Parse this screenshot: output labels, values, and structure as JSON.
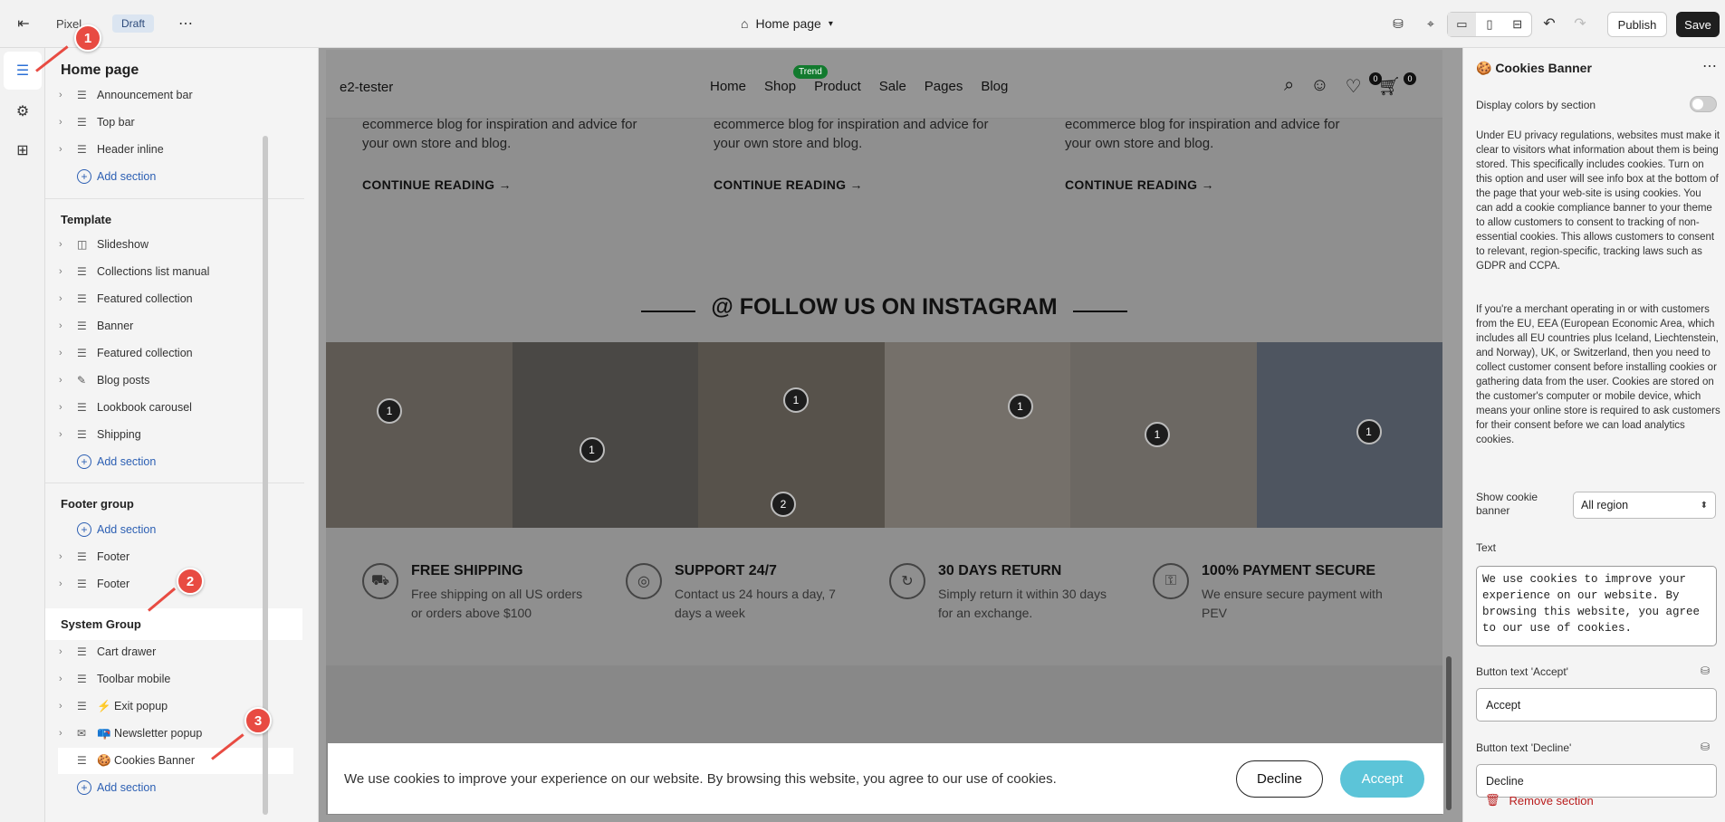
{
  "topbar": {
    "exit_icon": "exit-icon",
    "page_name_partial": "Pixel",
    "status_badge": "Draft",
    "more_icon": "more-horizontal-icon",
    "page_selector": "Home page",
    "publish_label": "Publish",
    "save_label": "Save"
  },
  "left_panel": {
    "title": "Home page",
    "header_items": [
      "Announcement bar",
      "Top bar",
      "Header inline"
    ],
    "add_section": "Add section",
    "template_title": "Template",
    "template_items": [
      "Slideshow",
      "Collections list manual",
      "Featured collection",
      "Banner",
      "Featured collection",
      "Blog posts",
      "Lookbook carousel",
      "Shipping"
    ],
    "footer_title": "Footer group",
    "footer_items": [
      "Footer",
      "Footer"
    ],
    "system_title": "System Group",
    "system_items": [
      "Cart drawer",
      "Toolbar mobile",
      "⚡ Exit popup",
      "📪 Newsletter popup",
      "🍪 Cookies Banner"
    ]
  },
  "store": {
    "logo": "e2-tester",
    "menu": [
      "Home",
      "Shop",
      "Product",
      "Sale",
      "Pages",
      "Blog"
    ],
    "trend_badge": "Trend",
    "wishlist_count": "0",
    "cart_count": "0",
    "blog_excerpt": "ecommerce blog for inspiration and advice for your own store and blog.",
    "continue_reading": "CONTINUE READING →",
    "instagram_heading": "@ FOLLOW US ON INSTAGRAM",
    "tile_pins": [
      [
        "1"
      ],
      [
        "1"
      ],
      [
        "1",
        "2"
      ],
      [
        "1"
      ],
      [
        "1"
      ],
      [
        "1"
      ]
    ],
    "features": [
      {
        "title": "FREE SHIPPING",
        "text": "Free shipping on all US orders or orders above $100"
      },
      {
        "title": "SUPPORT 24/7",
        "text": "Contact us 24 hours a day, 7 days a week"
      },
      {
        "title": "30 DAYS RETURN",
        "text": "Simply return it within 30 days for an exchange."
      },
      {
        "title": "100% PAYMENT SECURE",
        "text": "We ensure secure payment with PEV"
      }
    ],
    "cookie_text": "We use cookies to improve your experience on our website. By browsing this website, you agree to our use of cookies.",
    "decline_label": "Decline",
    "accept_label": "Accept"
  },
  "right_panel": {
    "title": "🍪 Cookies Banner",
    "display_colors_label": "Display colors by section",
    "desc1": "Under EU privacy regulations, websites must make it clear to visitors what information about them is being stored. This specifically includes cookies. Turn on this option and user will see info box at the bottom of the page that your web-site is using cookies. You can add a cookie compliance banner to your theme to allow customers to consent to tracking of non-essential cookies. This allows customers to consent to relevant, region-specific, tracking laws such as GDPR and CCPA.",
    "desc2": "If you're a merchant operating in or with customers from the EU, EEA (European Economic Area, which includes all EU countries plus Iceland, Liechtenstein, and Norway), UK, or Switzerland, then you need to collect customer consent before installing cookies or gathering data from the user. Cookies are stored on the customer's computer or mobile device, which means your online store is required to ask customers for their consent before we can load analytics cookies.",
    "show_banner_label": "Show cookie banner",
    "show_banner_value": "All region",
    "text_label": "Text",
    "text_value": "We use cookies to improve your experience on our website. By browsing this website, you agree to our use of cookies.",
    "accept_text_label": "Button text 'Accept'",
    "accept_text_value": "Accept",
    "decline_text_label": "Button text 'Decline'",
    "decline_text_value": "Decline",
    "remove_label": "Remove section"
  },
  "markers": [
    "1",
    "2",
    "3"
  ],
  "colors": {
    "accent": "#2c5fb3",
    "marker": "#e84b42",
    "accept": "#5cc4d8",
    "danger": "#b91c1c"
  }
}
